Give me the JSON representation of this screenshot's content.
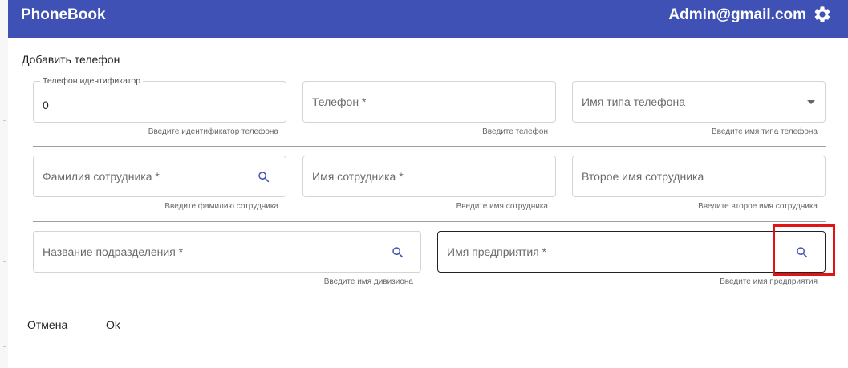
{
  "app": {
    "title": "PhoneBook",
    "user": "Admin@gmail.com"
  },
  "dialog": {
    "title": "Добавить телефон",
    "fields": {
      "phone_id": {
        "label": "Телефон идентификатор",
        "value": "0",
        "helper": "Введите идентификатор телефона"
      },
      "phone": {
        "placeholder": "Телефон *",
        "helper": "Введите телефон"
      },
      "phone_type": {
        "placeholder": "Имя типа телефона",
        "helper": "Введите имя типа телефона"
      },
      "last_name": {
        "placeholder": "Фамилия сотрудника *",
        "helper": "Введите фамилию сотрудника"
      },
      "first_name": {
        "placeholder": "Имя сотрудника *",
        "helper": "Введите имя сотрудника"
      },
      "middle_name": {
        "placeholder": "Второе имя сотрудника",
        "helper": "Введите второе имя сотрудника"
      },
      "division": {
        "placeholder": "Название подразделения *",
        "helper": "Введите имя дивизиона"
      },
      "enterprise": {
        "placeholder": "Имя предприятия *",
        "helper": "Введите имя предприятия"
      }
    },
    "buttons": {
      "cancel": "Отмена",
      "ok": "Ok"
    }
  },
  "colors": {
    "appbar": "#3f51b5",
    "search_icon": "#3f51b5",
    "highlight": "#e01414"
  }
}
